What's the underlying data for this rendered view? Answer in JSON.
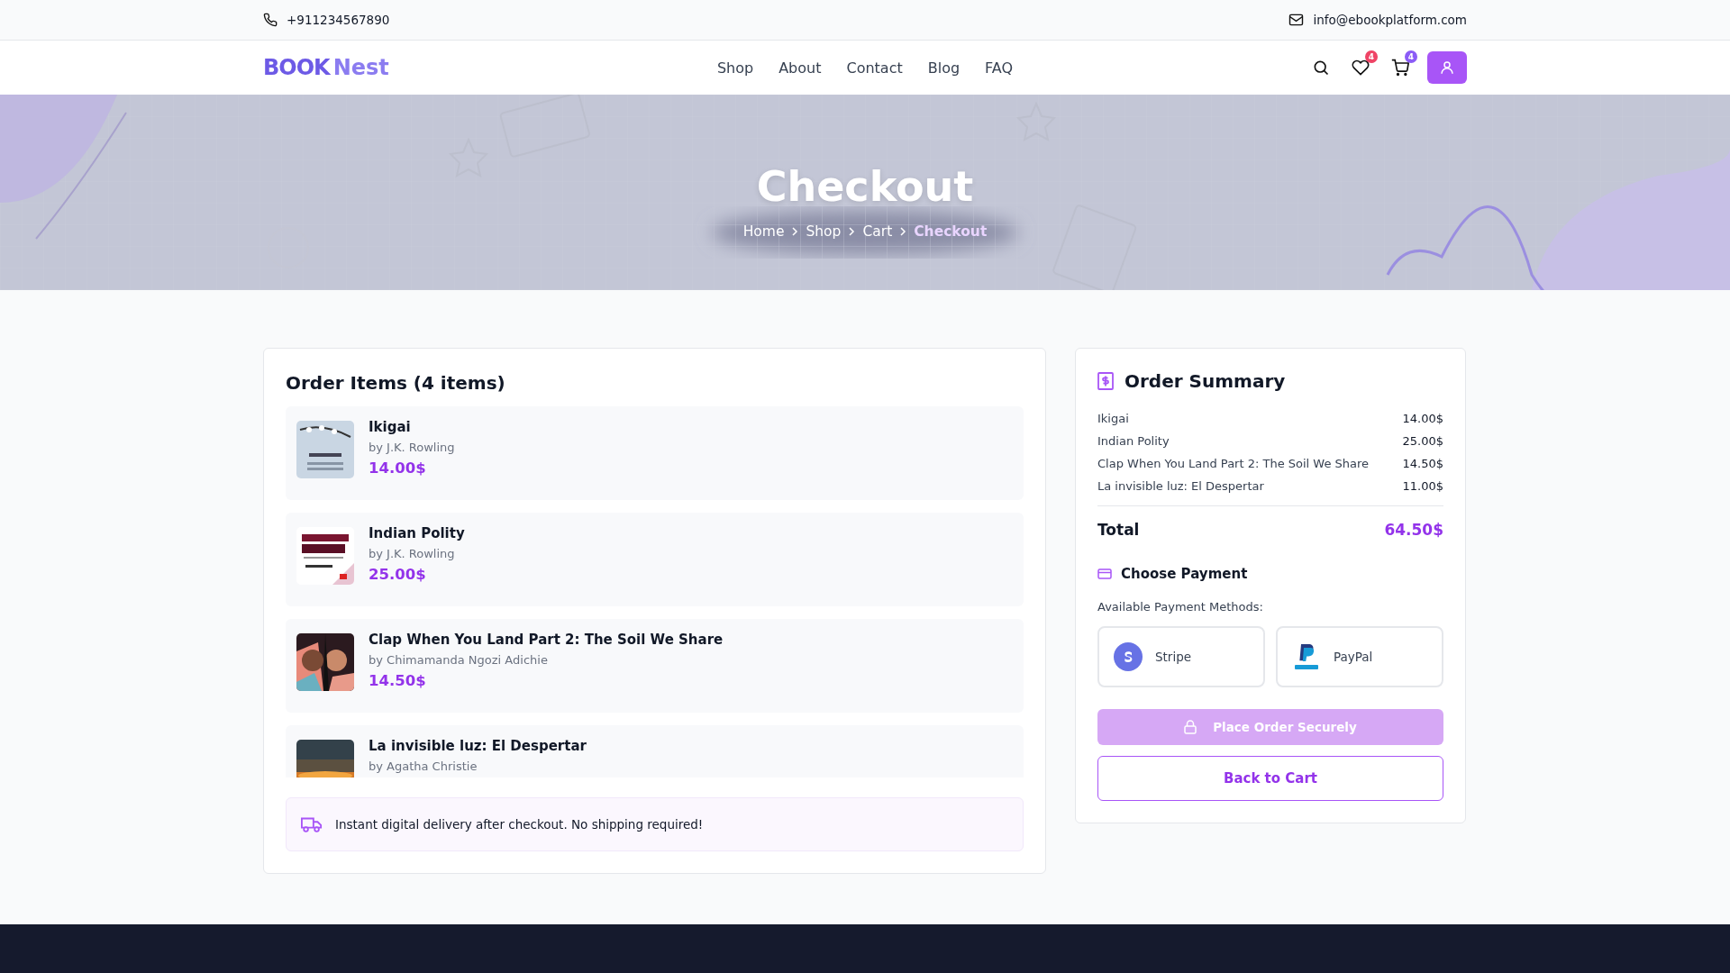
{
  "topbar": {
    "phone": "+911234567890",
    "email": "info@ebookplatform.com"
  },
  "nav": {
    "logo": {
      "first": "BOOK",
      "second": "Nest"
    },
    "links": [
      {
        "label": "Shop"
      },
      {
        "label": "About"
      },
      {
        "label": "Contact"
      },
      {
        "label": "Blog"
      },
      {
        "label": "FAQ"
      }
    ],
    "wishlist_count": "4",
    "cart_count": "4"
  },
  "hero": {
    "title": "Checkout",
    "breadcrumb": [
      {
        "label": "Home",
        "selected": false
      },
      {
        "label": "Shop",
        "selected": false
      },
      {
        "label": "Cart",
        "selected": false
      },
      {
        "label": "Checkout",
        "selected": true
      }
    ]
  },
  "order_items": {
    "title": "Order Items (4 items)",
    "items": [
      {
        "title": "Ikigai",
        "author": "by J.K. Rowling",
        "price": "14.00$"
      },
      {
        "title": "Indian Polity",
        "author": "by J.K. Rowling",
        "price": "25.00$"
      },
      {
        "title": "Clap When You Land Part 2: The Soil We Share",
        "author": "by Chimamanda Ngozi Adichie",
        "price": "14.50$"
      },
      {
        "title": "La invisible luz: El Despertar",
        "author": "by Agatha Christie"
      }
    ],
    "notice": "Instant digital delivery after checkout. No shipping required!"
  },
  "summary": {
    "title": "Order Summary",
    "lines": [
      {
        "name": "Ikigai",
        "amount": "14.00$"
      },
      {
        "name": "Indian Polity",
        "amount": "25.00$"
      },
      {
        "name": "Clap When You Land Part 2: The Soil We Share",
        "amount": "14.50$"
      },
      {
        "name": "La invisible luz: El Despertar",
        "amount": "11.00$"
      }
    ],
    "total_label": "Total",
    "total": "64.50$",
    "payment_title": "Choose Payment",
    "methods_label": "Available Payment Methods:",
    "methods": [
      {
        "label": "Stripe",
        "kind": "stripe"
      },
      {
        "label": "PayPal",
        "kind": "paypal"
      }
    ],
    "place_order": {
      "label": "Place Order Securely",
      "disabled": true
    },
    "back": "Back to Cart"
  }
}
